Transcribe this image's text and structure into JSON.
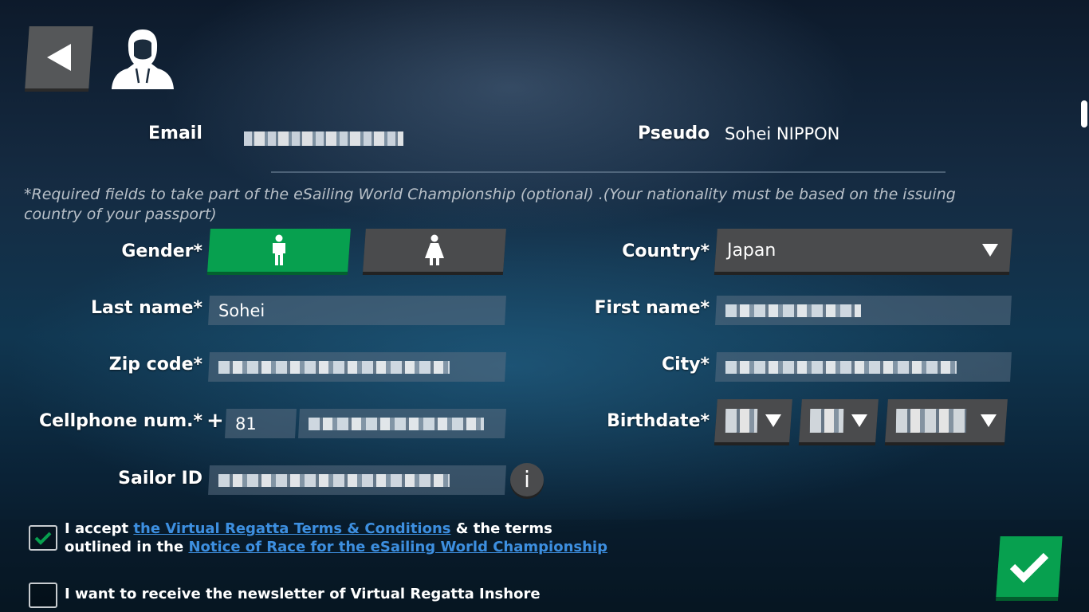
{
  "header": {
    "back_icon": "back-arrow-icon",
    "avatar_icon": "hooded-sailor-avatar-icon"
  },
  "account": {
    "email_label": "Email",
    "pseudo_label": "Pseudo",
    "pseudo_value": "Sohei NIPPON"
  },
  "note": "*Required fields to take part of the eSailing World Championship (optional) .(Your nationality must be based on the issuing country of your passport)",
  "form": {
    "gender_label": "Gender*",
    "gender_selected": "male",
    "last_name_label": "Last name*",
    "last_name_value": "Sohei",
    "zip_label": "Zip code*",
    "cellphone_label": "Cellphone num.*",
    "plus_sign": "+",
    "country_code": "81",
    "sailor_id_label": "Sailor ID",
    "info_label": "i",
    "country_label": "Country*",
    "country_value": "Japan",
    "first_name_label": "First name*",
    "city_label": "City*",
    "birthdate_label": "Birthdate*"
  },
  "consents": {
    "terms_prefix": "I accept ",
    "terms_link": "the Virtual Regatta Terms & Conditions",
    "terms_mid": " & the terms",
    "terms_line2_prefix": "outlined in the ",
    "notice_link": "Notice of Race for the eSailing World Championship",
    "terms_checked": true,
    "newsletter": "I want to receive the newsletter of Virtual Regatta Inshore",
    "newsletter_checked": false
  },
  "colors": {
    "accent_green": "#07a04f",
    "link_blue": "#3d8fe0",
    "button_gray": "#4a4b4d"
  }
}
